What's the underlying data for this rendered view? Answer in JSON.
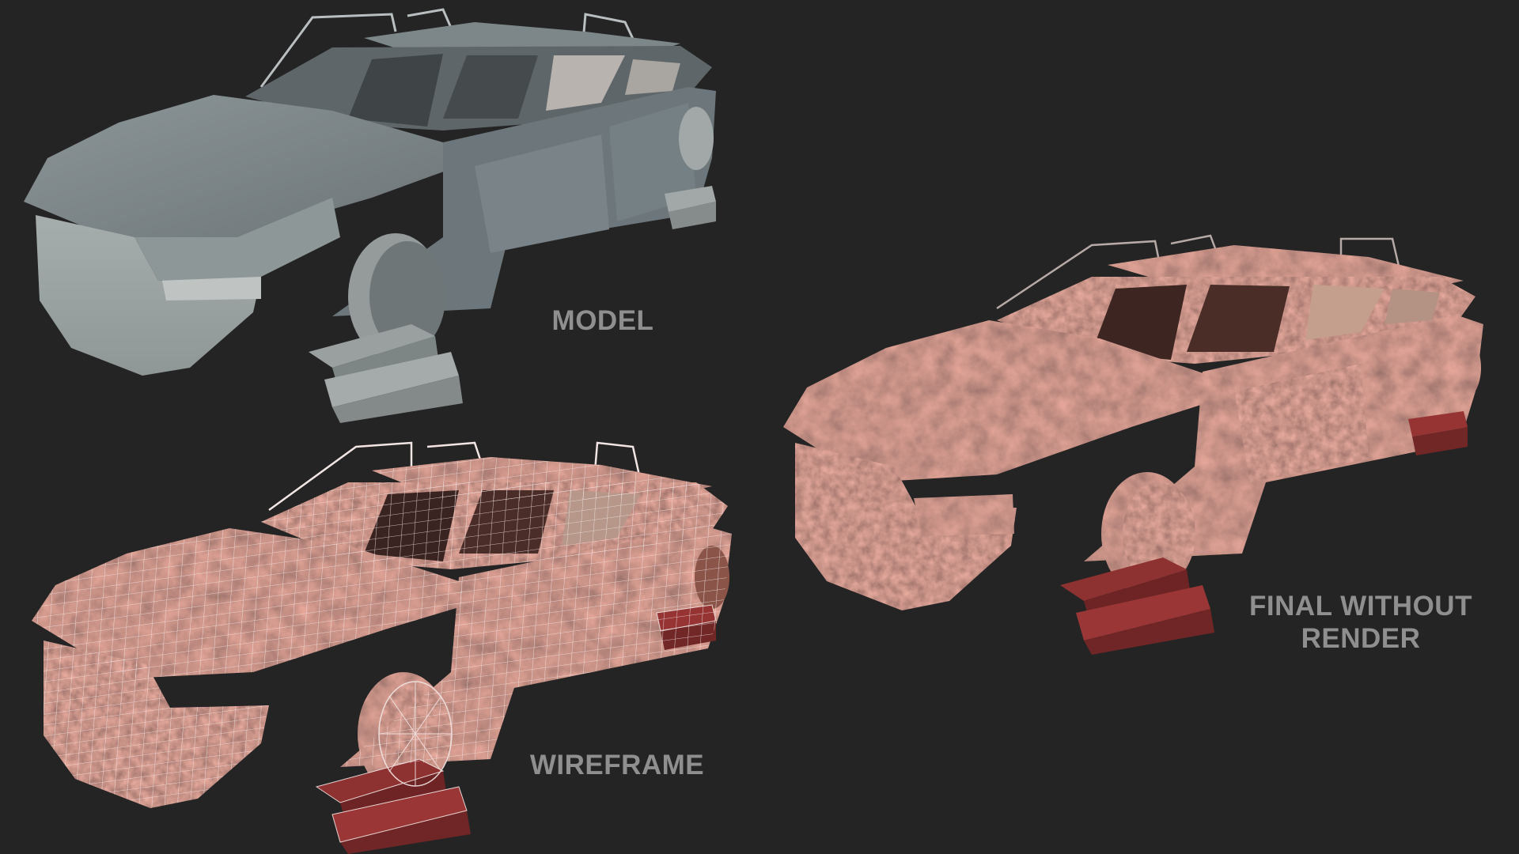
{
  "labels": {
    "model": "MODEL",
    "wireframe": "WIREFRAME",
    "final_line1": "FINAL WITHOUT",
    "final_line2": "RENDER"
  },
  "colors": {
    "background": "#242424",
    "label": "#8f8f8f",
    "model_body": "#7b8488",
    "model_light": "#a9afb0",
    "rust_base": "#8a5448",
    "rust_dark": "#5e3a34",
    "wire": "#f2e6e4",
    "blocks_rust": "#8a2f2f"
  },
  "views": [
    {
      "name": "model",
      "style": "solid-grey"
    },
    {
      "name": "wireframe",
      "style": "rust-with-white-wire"
    },
    {
      "name": "final",
      "style": "rust-textured"
    }
  ]
}
